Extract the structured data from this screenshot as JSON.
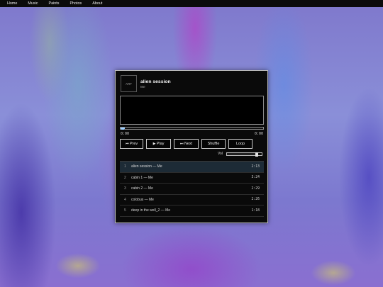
{
  "nav": {
    "items": [
      {
        "label": "Home"
      },
      {
        "label": "Music"
      },
      {
        "label": "Paints"
      },
      {
        "label": "Photos"
      },
      {
        "label": "About"
      }
    ]
  },
  "player": {
    "art_label": "ART",
    "title": "alien session",
    "artist": "Me",
    "progress_fraction": 0.03,
    "time_current": "0:00",
    "time_duration": "0:00",
    "buttons": {
      "prev": {
        "icon": "prev-icon",
        "glyph": "⏮",
        "label": "Prev"
      },
      "play": {
        "icon": "play-icon",
        "glyph": "▶",
        "label": "Play"
      },
      "next": {
        "icon": "next-icon",
        "glyph": "⏭",
        "label": "Next"
      },
      "shuffle": {
        "label": "Shuffle"
      },
      "loop": {
        "label": "Loop"
      }
    },
    "volume_label": "Vol",
    "volume_fraction": 0.9,
    "accent_color": "#8fc6ff",
    "active_row_color": "#1d2b36"
  },
  "playlist": [
    {
      "num": "1",
      "name": "alien session — Me",
      "duration": "2:13",
      "active": true
    },
    {
      "num": "2",
      "name": "cabin 1 — Me",
      "duration": "3:24",
      "active": false
    },
    {
      "num": "3",
      "name": "cabin 2 — Me",
      "duration": "2:29",
      "active": false
    },
    {
      "num": "4",
      "name": "colobus — Me",
      "duration": "2:26",
      "active": false
    },
    {
      "num": "5",
      "name": "deep in the well_2 — Me",
      "duration": "1:18",
      "active": false
    }
  ]
}
